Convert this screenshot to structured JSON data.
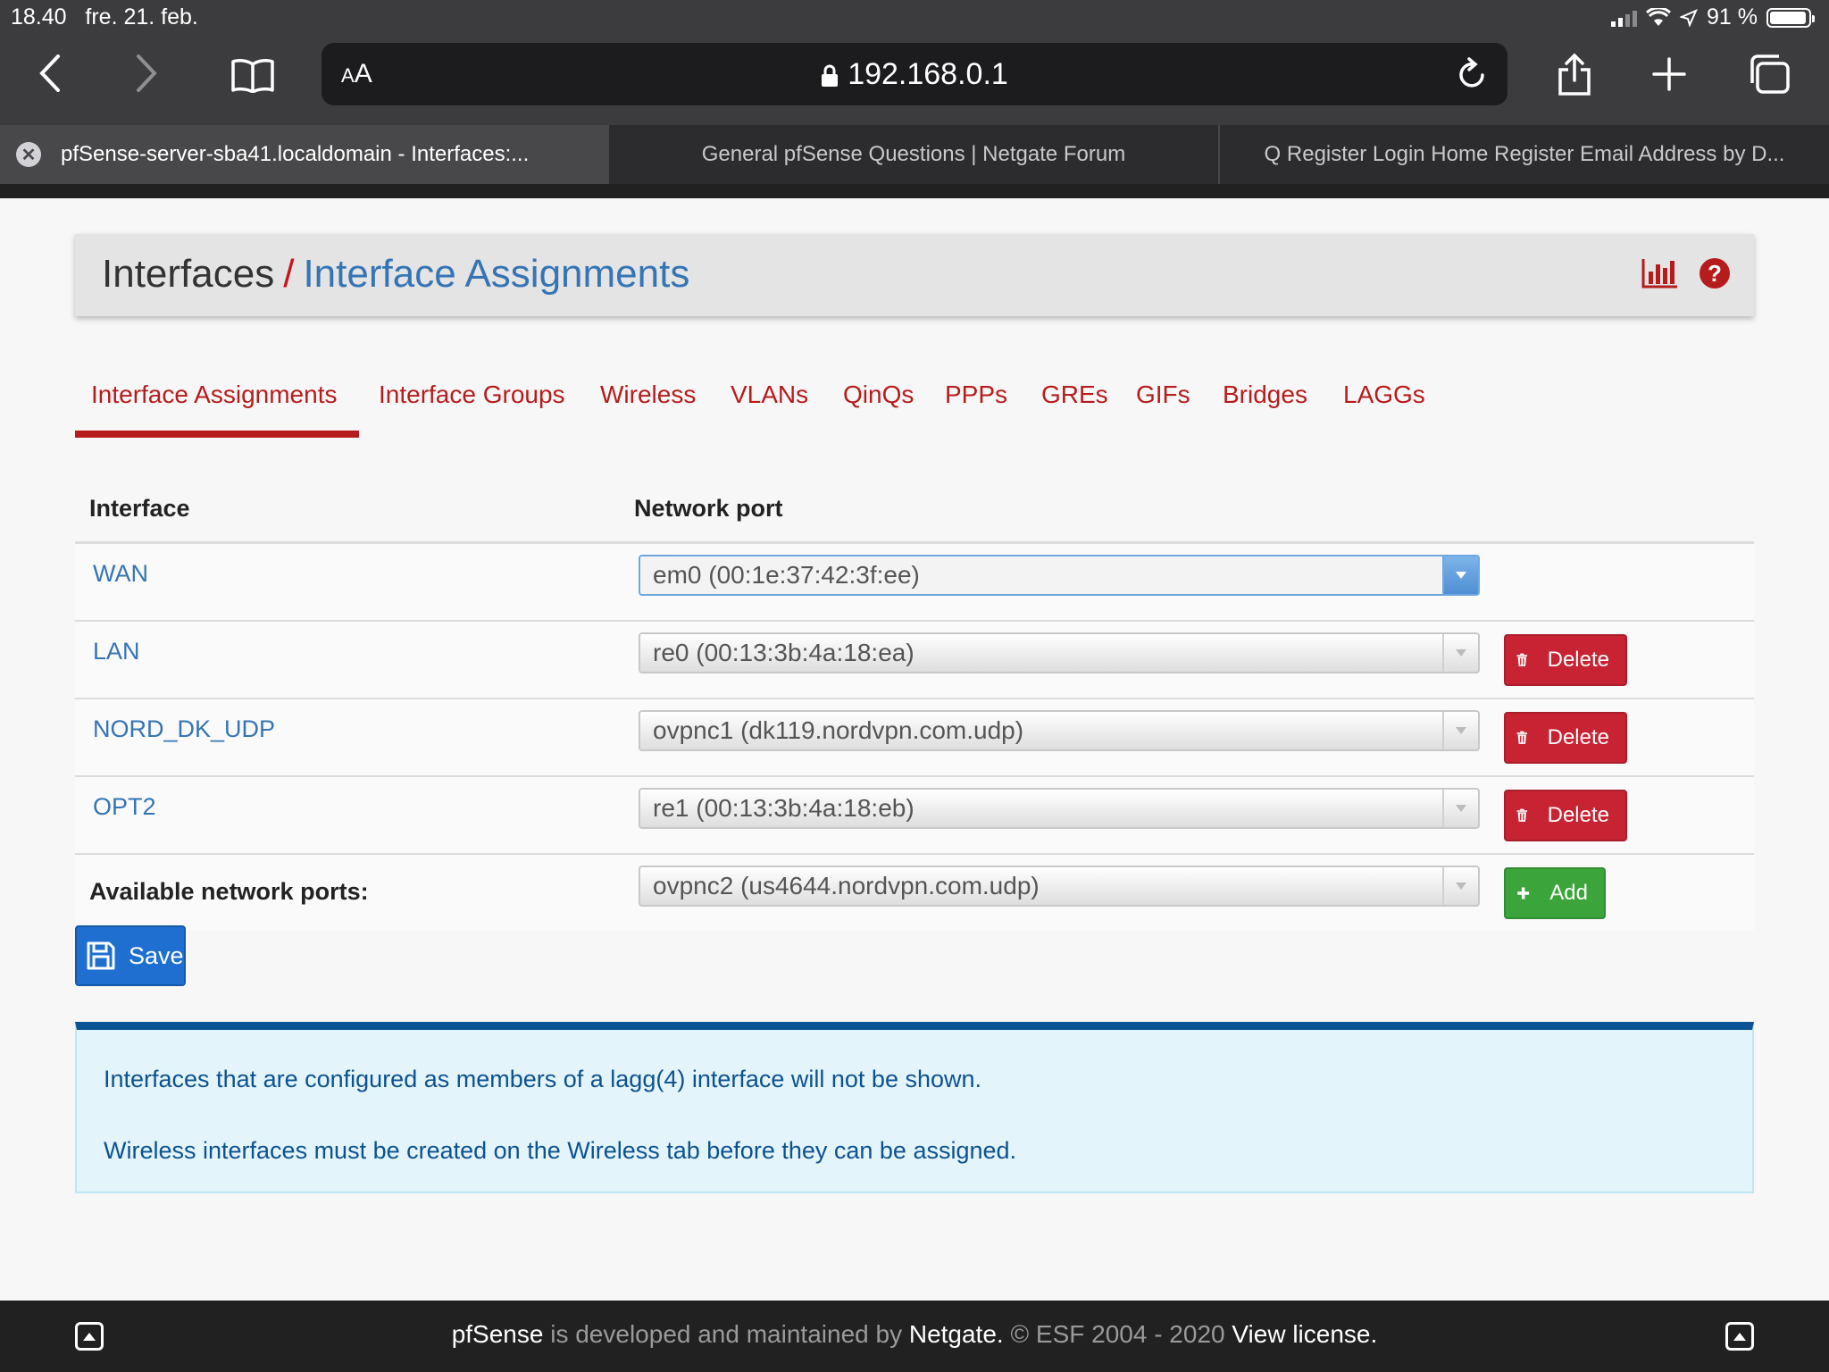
{
  "statusbar": {
    "time": "18.40",
    "date": "fre. 21. feb.",
    "battery": "91 %"
  },
  "browser": {
    "aa_label_small": "A",
    "aa_label_large": "A",
    "url": "192.168.0.1",
    "tabs": [
      {
        "label": "pfSense-server-sba41.localdomain - Interfaces:..."
      },
      {
        "label": "General pfSense Questions | Netgate Forum"
      },
      {
        "label": "Q Register Login Home Register Email Address by D..."
      }
    ]
  },
  "header": {
    "section": "Interfaces",
    "separator": "/",
    "current": "Interface Assignments"
  },
  "navtabs": [
    {
      "label": "Interface Assignments"
    },
    {
      "label": "Interface Groups"
    },
    {
      "label": "Wireless"
    },
    {
      "label": "VLANs"
    },
    {
      "label": "QinQs"
    },
    {
      "label": "PPPs"
    },
    {
      "label": "GREs"
    },
    {
      "label": "GIFs"
    },
    {
      "label": "Bridges"
    },
    {
      "label": "LAGGs"
    }
  ],
  "table": {
    "col_interface": "Interface",
    "col_port": "Network port",
    "rows": [
      {
        "name": "WAN",
        "port": "em0 (00:1e:37:42:3f:ee)"
      },
      {
        "name": "LAN",
        "port": "re0 (00:13:3b:4a:18:ea)",
        "action": "Delete"
      },
      {
        "name": "NORD_DK_UDP",
        "port": "ovpnc1 (dk119.nordvpn.com.udp)",
        "action": "Delete"
      },
      {
        "name": "OPT2",
        "port": "re1 (00:13:3b:4a:18:eb)",
        "action": "Delete"
      }
    ],
    "available_label": "Available network ports:",
    "available_port": "ovpnc2 (us4644.nordvpn.com.udp)",
    "add_label": "Add"
  },
  "save_label": "Save",
  "info": {
    "line1": "Interfaces that are configured as members of a lagg(4) interface will not be shown.",
    "line2": "Wireless interfaces must be created on the Wireless tab before they can be assigned."
  },
  "footer": {
    "brand": "pfSense",
    "text1": " is developed and maintained by ",
    "company": "Netgate.",
    "text2": " © ESF 2004 - 2020 ",
    "license": "View license."
  },
  "colors": {
    "accent_red": "#b71c1c",
    "link_blue": "#3575b5",
    "save_blue": "#1e6fd0",
    "add_green": "#3ba53b",
    "info_bg": "#e3f4fb"
  }
}
